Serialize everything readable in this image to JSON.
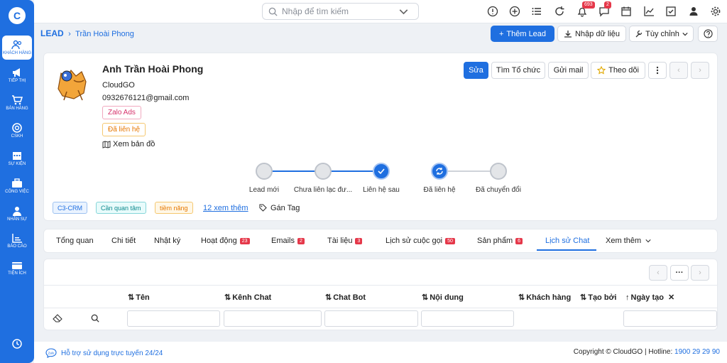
{
  "sidebar": {
    "logo": "C",
    "items": [
      {
        "label": "KHÁCH HÀNG",
        "icon": "users-icon"
      },
      {
        "label": "TIẾP THỊ",
        "icon": "megaphone-icon"
      },
      {
        "label": "BÁN HÀNG",
        "icon": "cart-icon"
      },
      {
        "label": "CSKH",
        "icon": "lifebuoy-icon"
      },
      {
        "label": "SỰ KIỆN",
        "icon": "calendar-icon"
      },
      {
        "label": "CÔNG VIỆC",
        "icon": "briefcase-icon"
      },
      {
        "label": "NHÂN SỰ",
        "icon": "person-icon"
      },
      {
        "label": "BÁO CÁO",
        "icon": "chart-icon"
      },
      {
        "label": "TIỆN ÍCH",
        "icon": "box-icon"
      }
    ],
    "bottom_icon": "clock-icon"
  },
  "topbar": {
    "search_placeholder": "Nhập để tìm kiếm",
    "notification_count": "693",
    "message_count": "2"
  },
  "breadcrumb": {
    "root": "LEAD",
    "current": "Trần Hoài Phong"
  },
  "header_actions": {
    "add_lead": "Thêm Lead",
    "import": "Nhập dữ liệu",
    "customize": "Tùy chỉnh"
  },
  "profile": {
    "name": "Anh Trần Hoài Phong",
    "company": "CloudGO",
    "phone_email": "0932676121@gmail.com",
    "source_tag": "Zalo Ads",
    "status_tag": "Đã liên hệ",
    "map_link": "Xem bản đồ"
  },
  "actions": {
    "edit": "Sửa",
    "find_org": "Tìm Tổ chức",
    "send_mail": "Gửi mail",
    "follow": "Theo dõi"
  },
  "pipeline": {
    "stages": [
      "Lead mới",
      "Chưa liên lạc đư...",
      "Liên hệ sau",
      "Đã liên hệ",
      "Đã chuyển đổi"
    ],
    "current_index": 3
  },
  "tags": {
    "items": [
      "C3-CRM",
      "Cần quan tâm",
      "tiềm năng"
    ],
    "more": "12 xem thêm",
    "add_tag": "Gán Tag"
  },
  "tabs": [
    {
      "label": "Tổng quan",
      "count": ""
    },
    {
      "label": "Chi tiết",
      "count": ""
    },
    {
      "label": "Nhật ký",
      "count": ""
    },
    {
      "label": "Hoạt động",
      "count": "23"
    },
    {
      "label": "Emails",
      "count": "2"
    },
    {
      "label": "Tài liệu",
      "count": "3"
    },
    {
      "label": "Lịch sử cuộc gọi",
      "count": "50"
    },
    {
      "label": "Sản phẩm",
      "count": "6"
    },
    {
      "label": "Lịch sử Chat",
      "count": ""
    },
    {
      "label": "Xem thêm",
      "count": ""
    }
  ],
  "active_tab": "Lịch sử Chat",
  "table": {
    "columns": [
      "Tên",
      "Kênh Chat",
      "Chat Bot",
      "Nội dung",
      "Khách hàng",
      "Tạo bởi",
      "Ngày tạo"
    ]
  },
  "footer": {
    "support": "Hỗ trợ sử dụng trực tuyến 24/24",
    "copyright": "Copyright © CloudGO | Hotline: ",
    "hotline": "1900 29 29 90"
  },
  "colors": {
    "brand": "#1f6fe0",
    "badge": "#e5384a",
    "zalo_tag": "#d6336c",
    "status_tag": "#e67700"
  }
}
